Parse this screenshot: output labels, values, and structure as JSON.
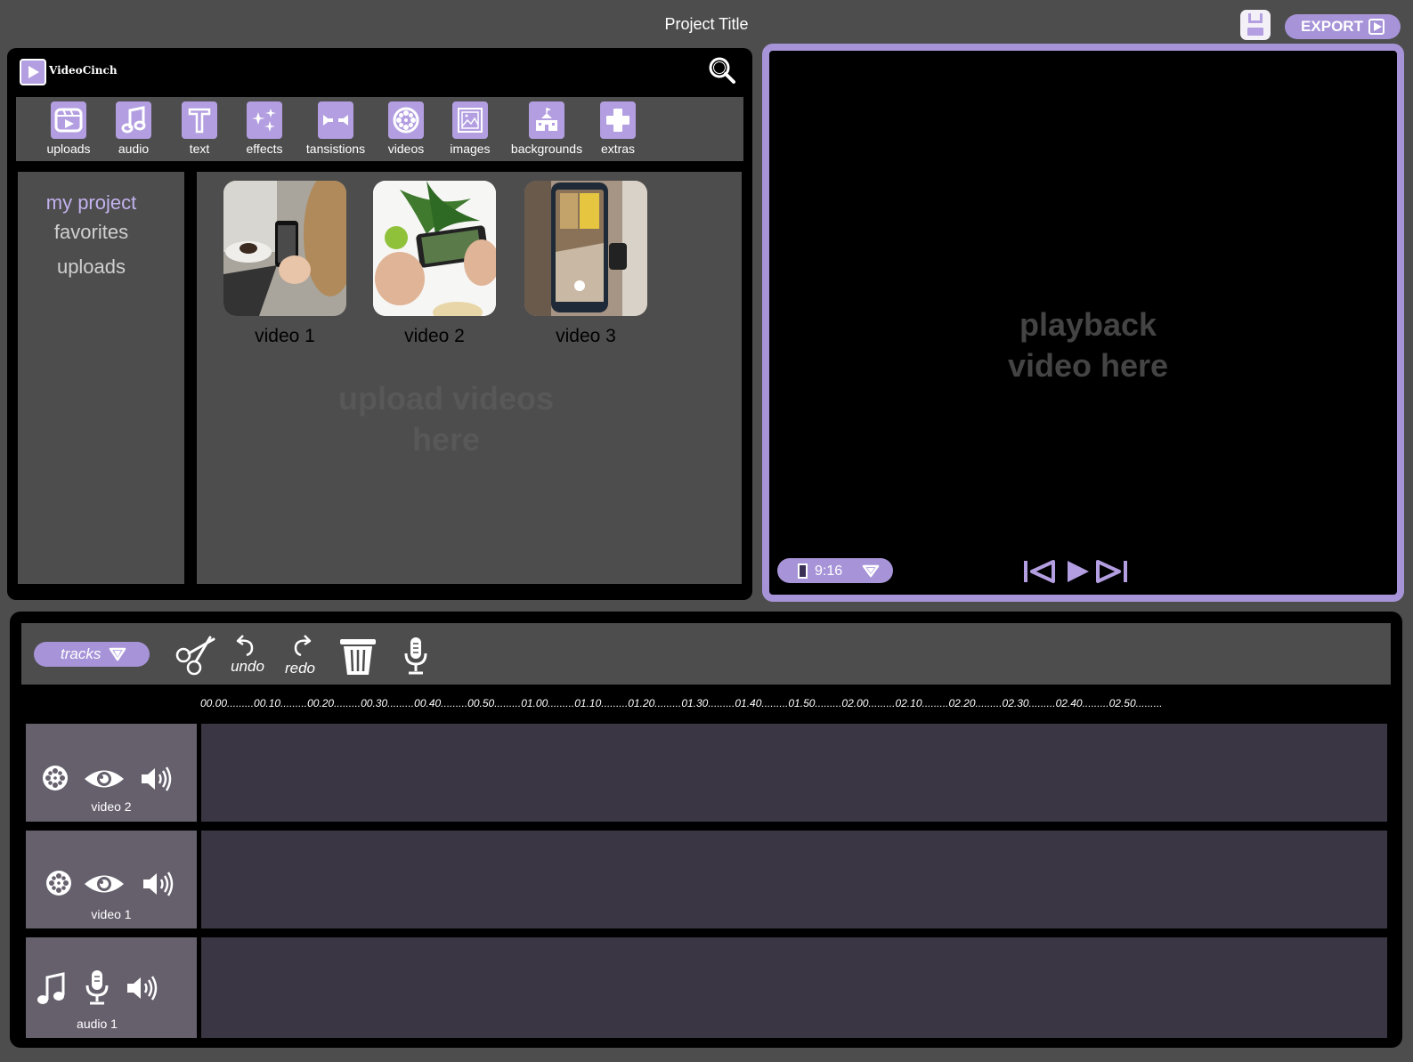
{
  "header": {
    "title": "Project Title",
    "export_label": "EXPORT"
  },
  "brand": {
    "name": "VideoCinch"
  },
  "toolbar": {
    "items": [
      {
        "label": "uploads"
      },
      {
        "label": "audio"
      },
      {
        "label": "text"
      },
      {
        "label": "effects"
      },
      {
        "label": "tansistions"
      },
      {
        "label": "videos"
      },
      {
        "label": "images"
      },
      {
        "label": "backgrounds"
      },
      {
        "label": "extras"
      }
    ]
  },
  "sidebar": {
    "items": [
      {
        "label": "my project",
        "active": true
      },
      {
        "label": "favorites",
        "active": false
      },
      {
        "label": "uploads",
        "active": false
      }
    ]
  },
  "media": {
    "items": [
      {
        "label": "video 1"
      },
      {
        "label": "video 2"
      },
      {
        "label": "video 3"
      }
    ],
    "placeholder": "upload videos here"
  },
  "player": {
    "placeholder": "playback video here",
    "aspect_ratio": "9:16"
  },
  "timeline": {
    "tracks_label": "tracks",
    "undo_label": "undo",
    "redo_label": "redo",
    "ruler": "00.00.........00.10.........00.20.........00.30.........00.40.........00.50.........01.00.........01.10.........01.20.........01.30.........01.40.........01.50.........02.00.........02.10.........02.20.........02.30.........02.40.........02.50.........",
    "tracks": [
      {
        "name": "video 2",
        "type": "video"
      },
      {
        "name": "video 1",
        "type": "video"
      },
      {
        "name": "audio 1",
        "type": "audio"
      }
    ]
  },
  "colors": {
    "accent": "#a794d8",
    "accent_light": "#b29ee0",
    "background": "#4d4d4d",
    "panel": "#000000",
    "track_body": "#3b3643",
    "track_head": "#66606d"
  }
}
